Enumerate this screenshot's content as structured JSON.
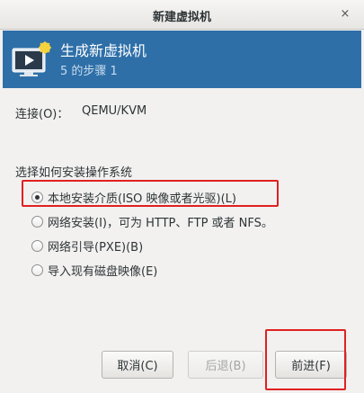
{
  "window": {
    "title": "新建虚拟机",
    "close_glyph": "×"
  },
  "header": {
    "title": "生成新虚拟机",
    "subtitle": "5 的步骤 1",
    "icon": "new-vm-monitor-icon"
  },
  "connection": {
    "label": "连接(O)：",
    "value": "QEMU/KVM"
  },
  "install": {
    "label": "选择如何安装操作系统",
    "options": [
      {
        "label": "本地安装介质(ISO 映像或者光驱)(L)",
        "checked": true
      },
      {
        "label": "网络安装(I)，可为 HTTP、FTP 或者 NFS。",
        "checked": false
      },
      {
        "label": "网络引导(PXE)(B)",
        "checked": false
      },
      {
        "label": "导入现有磁盘映像(E)",
        "checked": false
      }
    ]
  },
  "buttons": {
    "cancel": "取消(C)",
    "back": "后退(B)",
    "forward": "前进(F)"
  },
  "colors": {
    "header_bg": "#2e6fa8",
    "highlight": "#e02020"
  }
}
